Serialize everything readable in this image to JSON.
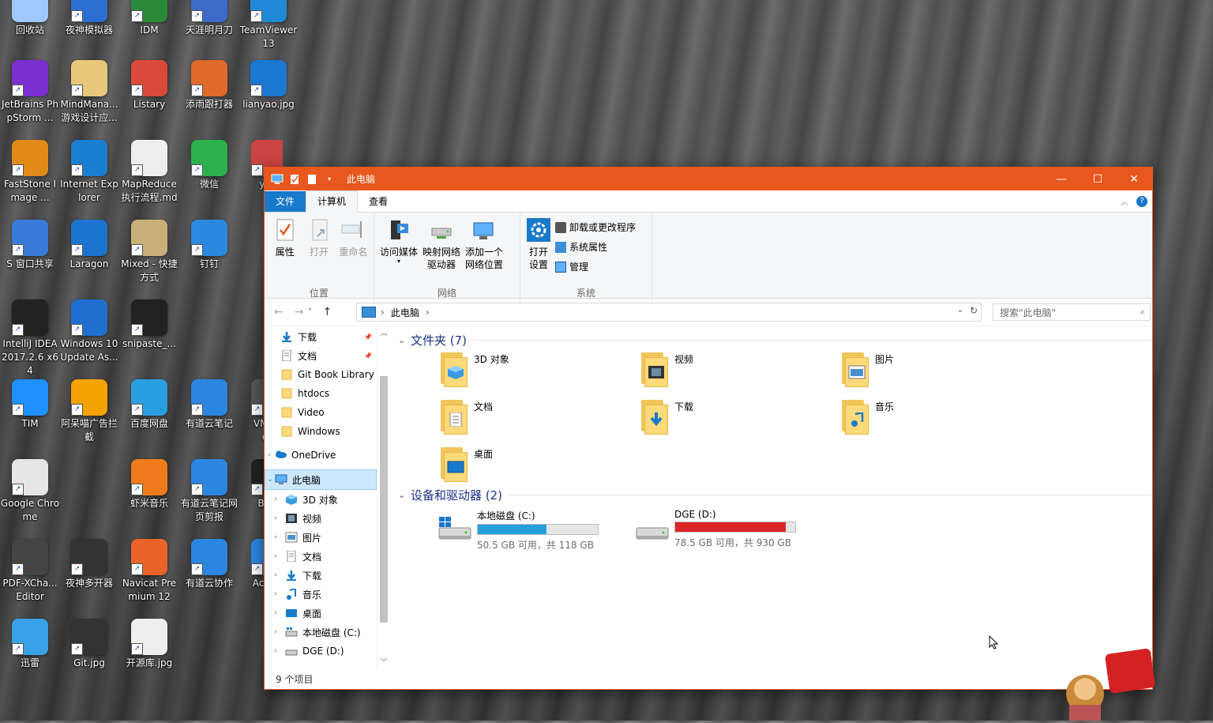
{
  "desktop": {
    "icons": [
      {
        "label": "回收站"
      },
      {
        "label": "夜神模拟器"
      },
      {
        "label": "IDM"
      },
      {
        "label": "天涯明月刀"
      },
      {
        "label": "TeamViewer 13"
      },
      {
        "label": "JetBrains PhpStorm ..."
      },
      {
        "label": "MindMana... 游戏设计应..."
      },
      {
        "label": "Listary"
      },
      {
        "label": "添雨跟打器"
      },
      {
        "label": "lianyao.jpg"
      },
      {
        "label": "FastStone Image ..."
      },
      {
        "label": "Internet Explorer"
      },
      {
        "label": "MapReduce 执行流程.md"
      },
      {
        "label": "微信"
      },
      {
        "label": "yar"
      },
      {
        "label": "S 窗口共享"
      },
      {
        "label": "Laragon"
      },
      {
        "label": "Mixed - 快捷方式"
      },
      {
        "label": "钉钉"
      },
      {
        "label": "IntelliJ IDEA 2017.2.6 x64"
      },
      {
        "label": "Windows 10 Update As..."
      },
      {
        "label": "snipaste_..."
      },
      {
        "label": "TIM"
      },
      {
        "label": "阿呆喵广告拦截"
      },
      {
        "label": "百度网盘"
      },
      {
        "label": "有道云笔记"
      },
      {
        "label": "VM Wor"
      },
      {
        "label": "Google Chrome"
      },
      {
        "label": "虾米音乐"
      },
      {
        "label": "有道云笔记网页剪报"
      },
      {
        "label": "Ban"
      },
      {
        "label": "PDF-XCha... Editor"
      },
      {
        "label": "夜神多开器"
      },
      {
        "label": "Navicat Premium 12"
      },
      {
        "label": "有道云协作"
      },
      {
        "label": "Ac True"
      },
      {
        "label": "迅雷"
      },
      {
        "label": "Git.jpg"
      },
      {
        "label": "开源库.jpg"
      }
    ]
  },
  "window": {
    "title": "此电脑",
    "controls": {
      "minimize": "—",
      "maximize": "☐",
      "close": "✕"
    },
    "tabs": {
      "file": "文件",
      "computer": "计算机",
      "view": "查看"
    },
    "help": "?",
    "ribbon": {
      "location": {
        "name": "位置",
        "properties": "属性",
        "open": "打开",
        "rename": "重命名"
      },
      "network": {
        "name": "网络",
        "access_media": "访问媒体",
        "map_drive": "映射网络驱动器",
        "add_location": "添加一个网络位置"
      },
      "system": {
        "name": "系统",
        "open_settings": "打开设置",
        "uninstall": "卸载或更改程序",
        "sys_props": "系统属性",
        "manage": "管理"
      }
    },
    "address": {
      "crumb": "此电脑",
      "search_placeholder": "搜索\"此电脑\""
    },
    "nav": {
      "quick": [
        {
          "label": "下载"
        },
        {
          "label": "文档"
        },
        {
          "label": "Git Book Library"
        },
        {
          "label": "htdocs"
        },
        {
          "label": "Video"
        },
        {
          "label": "Windows"
        }
      ],
      "onedrive": "OneDrive",
      "thispc": "此电脑",
      "pc_children": [
        {
          "label": "3D 对象"
        },
        {
          "label": "视频"
        },
        {
          "label": "图片"
        },
        {
          "label": "文档"
        },
        {
          "label": "下载"
        },
        {
          "label": "音乐"
        },
        {
          "label": "桌面"
        },
        {
          "label": "本地磁盘 (C:)"
        },
        {
          "label": "DGE (D:)"
        }
      ]
    },
    "folders_header": "文件夹 (7)",
    "folders": [
      {
        "label": "3D 对象",
        "overlay": "cube-icon"
      },
      {
        "label": "视频",
        "overlay": "film-icon"
      },
      {
        "label": "图片",
        "overlay": "picture-icon"
      },
      {
        "label": "文档",
        "overlay": "document-icon"
      },
      {
        "label": "下载",
        "overlay": "download-arrow-icon"
      },
      {
        "label": "音乐",
        "overlay": "music-note-icon"
      },
      {
        "label": "桌面",
        "overlay": "monitor-icon"
      }
    ],
    "drives_header": "设备和驱动器 (2)",
    "drives": [
      {
        "label": "本地磁盘 (C:)",
        "detail": "50.5 GB 可用，共 118 GB",
        "used_fraction": 0.57,
        "bar_color": "#26a0da"
      },
      {
        "label": "DGE (D:)",
        "detail": "78.5 GB 可用，共 930 GB",
        "used_fraction": 0.92,
        "bar_color": "#da2626"
      }
    ],
    "status": "9 个项目"
  },
  "colors": {
    "accent": "#e8571e",
    "file_tab": "#1979ca"
  }
}
